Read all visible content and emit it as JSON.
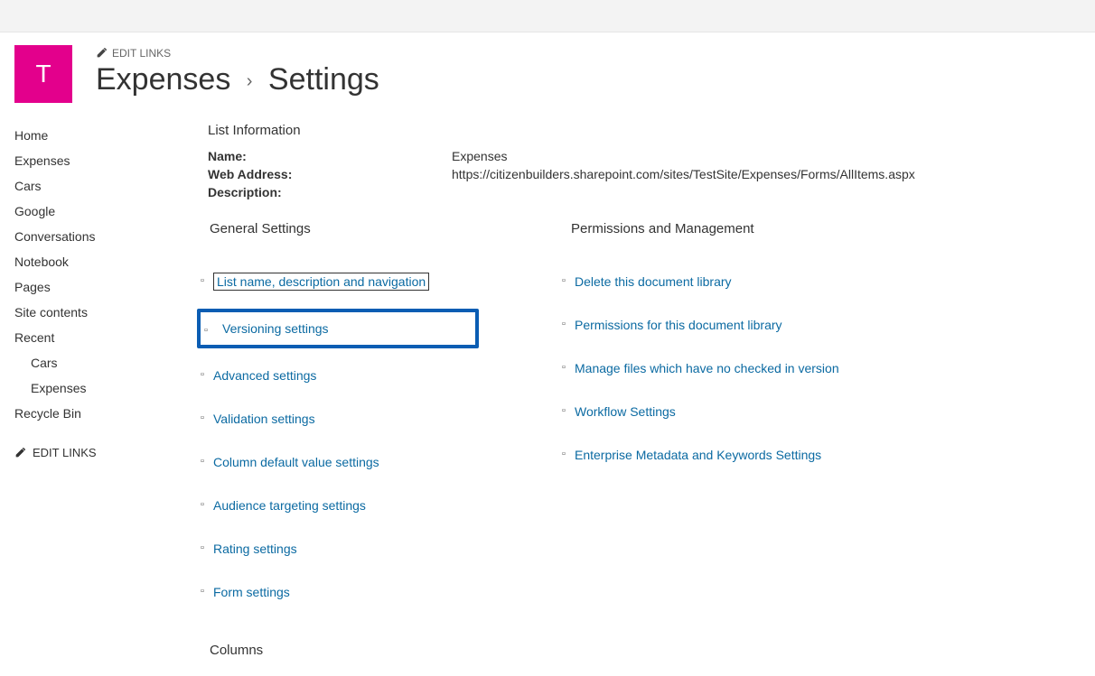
{
  "site_logo_letter": "T",
  "edit_links_label": "EDIT LINKS",
  "breadcrumb": {
    "lib": "Expenses",
    "page": "Settings"
  },
  "sidebar": {
    "items": [
      {
        "label": "Home",
        "nav": "home"
      },
      {
        "label": "Expenses",
        "nav": "expenses"
      },
      {
        "label": "Cars",
        "nav": "cars"
      },
      {
        "label": "Google",
        "nav": "google"
      },
      {
        "label": "Conversations",
        "nav": "conversations"
      },
      {
        "label": "Notebook",
        "nav": "notebook"
      },
      {
        "label": "Pages",
        "nav": "pages"
      },
      {
        "label": "Site contents",
        "nav": "site-contents"
      },
      {
        "label": "Recent",
        "nav": "recent"
      },
      {
        "label": "Cars",
        "nav": "recent-cars",
        "indent": true
      },
      {
        "label": "Expenses",
        "nav": "recent-expenses",
        "indent": true
      },
      {
        "label": "Recycle Bin",
        "nav": "recycle-bin"
      }
    ],
    "edit_links_label": "EDIT LINKS"
  },
  "list_info": {
    "heading": "List Information",
    "name_label": "Name:",
    "name_value": "Expenses",
    "addr_label": "Web Address:",
    "addr_value": "https://citizenbuilders.sharepoint.com/sites/TestSite/Expenses/Forms/AllItems.aspx",
    "desc_label": "Description:"
  },
  "general_settings": {
    "heading": "General Settings",
    "items": [
      {
        "label": "List name, description and navigation",
        "outlined": true
      },
      {
        "label": "Versioning settings",
        "highlighted": true
      },
      {
        "label": "Advanced settings"
      },
      {
        "label": "Validation settings"
      },
      {
        "label": "Column default value settings"
      },
      {
        "label": "Audience targeting settings"
      },
      {
        "label": "Rating settings"
      },
      {
        "label": "Form settings"
      }
    ]
  },
  "permissions": {
    "heading": "Permissions and Management",
    "items": [
      {
        "label": "Delete this document library"
      },
      {
        "label": "Permissions for this document library"
      },
      {
        "label": "Manage files which have no checked in version"
      },
      {
        "label": "Workflow Settings"
      },
      {
        "label": "Enterprise Metadata and Keywords Settings"
      }
    ]
  },
  "columns_heading": "Columns"
}
